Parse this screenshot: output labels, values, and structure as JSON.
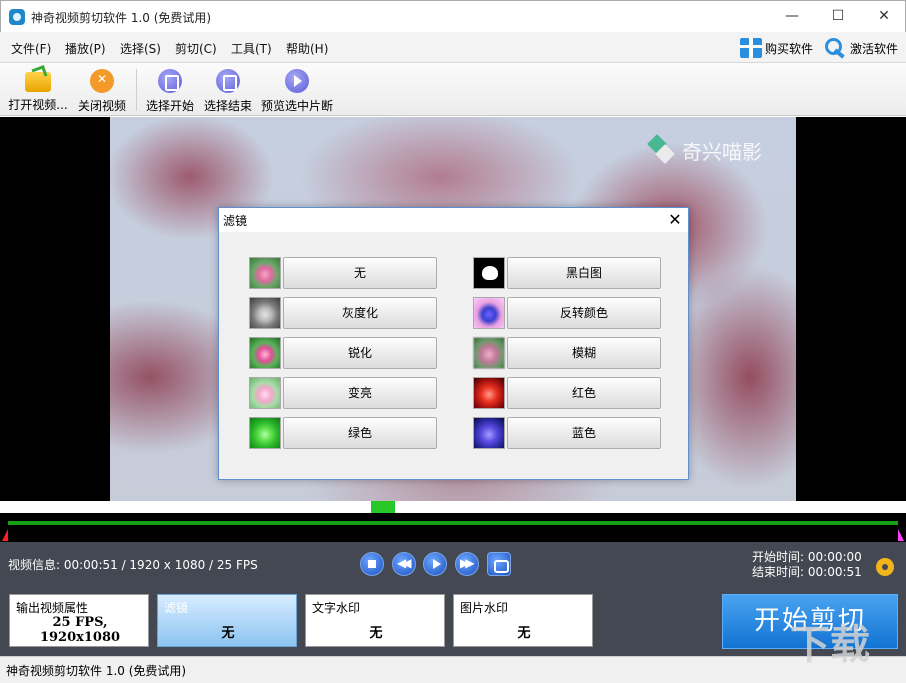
{
  "window": {
    "title": "神奇视频剪切软件 1.0 (免费试用)",
    "minimize": "—",
    "maximize": "☐",
    "close": "✕"
  },
  "menu": {
    "items": [
      "文件(F)",
      "播放(P)",
      "选择(S)",
      "剪切(C)",
      "工具(T)",
      "帮助(H)"
    ],
    "buy": "购买软件",
    "activate": "激活软件"
  },
  "toolbar": {
    "open_video": "打开视频...",
    "close_video": "关闭视频",
    "select_start": "选择开始",
    "select_end": "选择结束",
    "preview_segment": "预览选中片断"
  },
  "video": {
    "watermark": "奇兴喵影"
  },
  "filter_dialog": {
    "title": "滤镜",
    "close": "✕",
    "left_filters": [
      "无",
      "灰度化",
      "锐化",
      "变亮",
      "绿色"
    ],
    "right_filters": [
      "黑白图",
      "反转颜色",
      "模糊",
      "红色",
      "蓝色"
    ]
  },
  "info": {
    "video_info": "视频信息: 00:00:51 / 1920 x 1080 / 25 FPS",
    "start_time_label": "开始时间:",
    "start_time": "00:00:00",
    "end_time_label": "结束时间:",
    "end_time": "00:00:51"
  },
  "options": {
    "output_label": "输出视频属性",
    "output_value_line1": "25 FPS,",
    "output_value_line2": "1920x1080",
    "filter_label": "滤镜",
    "filter_value": "无",
    "text_wm_label": "文字水印",
    "text_wm_value": "无",
    "image_wm_label": "图片水印",
    "image_wm_value": "无"
  },
  "start_cut": "开始剪切",
  "status": {
    "text": "神奇视频剪切软件 1.0 (免费试用)"
  },
  "site_logo": "下载吧",
  "colors": {
    "accent": "#1a7fd8",
    "timeline_track": "#16a016",
    "panel": "#444852"
  }
}
